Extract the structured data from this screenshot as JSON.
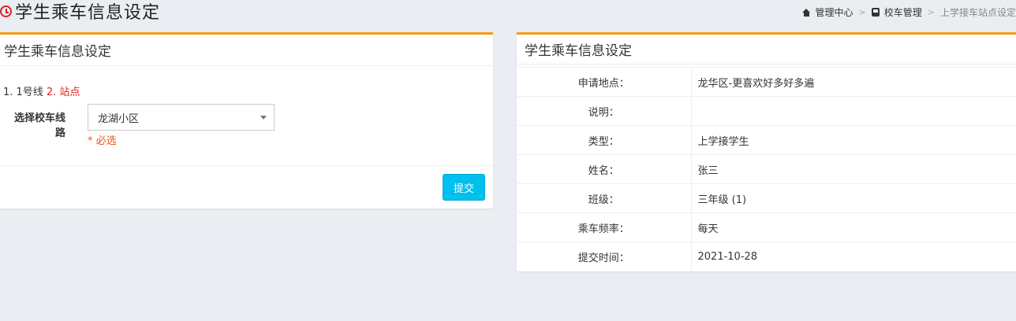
{
  "header": {
    "title": "学生乘车信息设定",
    "breadcrumb": {
      "home": "管理中心",
      "section": "校车管理",
      "current": "上学接车站点设定"
    }
  },
  "left_panel": {
    "title": "学生乘车信息设定",
    "steps": {
      "step1": "1. 1号线",
      "step2": "2. 站点"
    },
    "form": {
      "label": "选择校车线路",
      "selected": "龙湖小区",
      "required": "* 必选"
    },
    "submit": "提交"
  },
  "right_panel": {
    "title": "学生乘车信息设定",
    "rows": [
      {
        "label": "申请地点：",
        "value": "龙华区-更喜欢好多好多遍"
      },
      {
        "label": "说明：",
        "value": ""
      },
      {
        "label": "类型：",
        "value": "上学接学生"
      },
      {
        "label": "姓名：",
        "value": "张三"
      },
      {
        "label": "班级：",
        "value": "三年级 (1)"
      },
      {
        "label": "乘车频率：",
        "value": "每天"
      },
      {
        "label": "提交时间：",
        "value": "2021-10-28"
      }
    ]
  },
  "colors": {
    "accent": "#f39c12",
    "primary_button": "#00c0ef",
    "required": "#f0541e",
    "step_active": "#e02020"
  }
}
